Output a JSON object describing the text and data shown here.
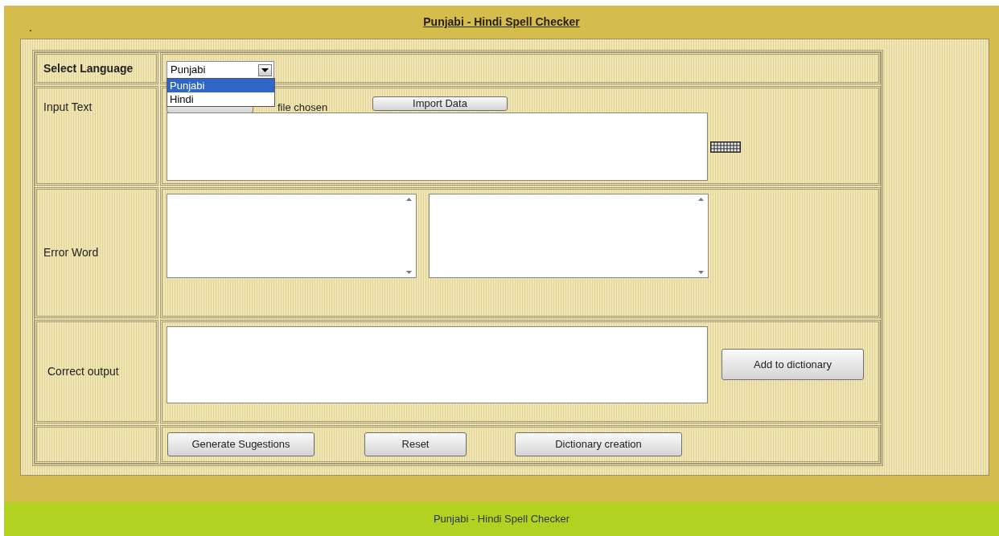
{
  "header": {
    "marker": ".",
    "title": "Punjabi - Hindi Spell Checker"
  },
  "form": {
    "language": {
      "label": "Select Language",
      "value": "Punjabi",
      "expanded": true,
      "options": [
        {
          "label": "Punjabi",
          "selected": true
        },
        {
          "label": "Hindi",
          "selected": false
        }
      ]
    },
    "input": {
      "label": "Input Text",
      "file_status": "file chosen",
      "import_button": "Import Data"
    },
    "error": {
      "label": "Error Word"
    },
    "output": {
      "label": "Correct output",
      "add_button": "Add to dictionary"
    },
    "buttons": [
      "Generate Sugestions",
      "Reset",
      "Dictionary creation"
    ]
  },
  "footer": "Punjabi - Hindi Spell Checker"
}
